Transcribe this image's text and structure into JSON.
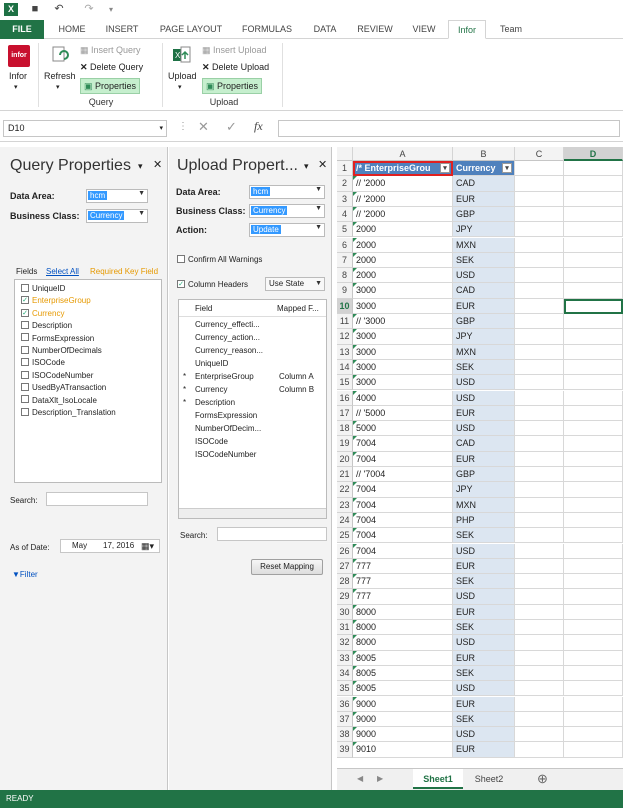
{
  "qat": {
    "logo": "X",
    "save_icon": "save-icon",
    "undo_icon": "undo-icon",
    "redo_icon": "redo-icon"
  },
  "tabs": [
    "FILE",
    "HOME",
    "INSERT",
    "PAGE LAYOUT",
    "FORMULAS",
    "DATA",
    "REVIEW",
    "VIEW",
    "Infor",
    "Team"
  ],
  "active_tab": "Infor",
  "ribbon": {
    "infor_label": "Infor",
    "infor_logo": "infor",
    "refresh_label": "Refresh",
    "insert_query": "Insert Query",
    "delete_query": "Delete Query",
    "query_properties": "Properties",
    "query_group": "Query",
    "upload_label": "Upload",
    "insert_upload": "Insert Upload",
    "delete_upload": "Delete Upload",
    "upload_properties": "Properties",
    "upload_group": "Upload"
  },
  "formula_bar": {
    "name_box": "D10",
    "cancel": "✕",
    "enter": "✓",
    "fx": "fx",
    "formula": ""
  },
  "query_panel": {
    "title": "Query Properties",
    "data_area_label": "Data Area:",
    "data_area_value": "hcm",
    "business_class_label": "Business Class:",
    "business_class_value": "Currency",
    "fields_label": "Fields",
    "select_all": "Select All",
    "required_key": "Required Key Field",
    "fields": [
      {
        "label": "UniqueID",
        "checked": false,
        "required": false
      },
      {
        "label": "EnterpriseGroup",
        "checked": true,
        "required": true
      },
      {
        "label": "Currency",
        "checked": true,
        "required": true
      },
      {
        "label": "Description",
        "checked": false,
        "required": false
      },
      {
        "label": "FormsExpression",
        "checked": false,
        "required": false
      },
      {
        "label": "NumberOfDecimals",
        "checked": false,
        "required": false
      },
      {
        "label": "ISOCode",
        "checked": false,
        "required": false
      },
      {
        "label": "ISOCodeNumber",
        "checked": false,
        "required": false
      },
      {
        "label": "UsedByATransaction",
        "checked": false,
        "required": false
      },
      {
        "label": "DataXlt_IsoLocale",
        "checked": false,
        "required": false
      },
      {
        "label": "Description_Translation",
        "checked": false,
        "required": false
      }
    ],
    "search_label": "Search:",
    "as_of_date_label": "As of Date:",
    "as_of_month": "May",
    "as_of_day": "17, 2016",
    "filter_label": "Filter"
  },
  "upload_panel": {
    "title": "Upload Propert...",
    "data_area_label": "Data Area:",
    "data_area_value": "hcm",
    "business_class_label": "Business Class:",
    "business_class_value": "Currency",
    "action_label": "Action:",
    "action_value": "Update",
    "confirm_warnings": "Confirm All Warnings",
    "column_headers": "Column Headers",
    "use_state": "Use State",
    "field_header": "Field",
    "mapped_header": "Mapped F...",
    "mappings": [
      {
        "star": "",
        "field": "Currency_effecti...",
        "mapped": ""
      },
      {
        "star": "",
        "field": "Currency_action...",
        "mapped": ""
      },
      {
        "star": "",
        "field": "Currency_reason...",
        "mapped": ""
      },
      {
        "star": "",
        "field": "UniqueID",
        "mapped": ""
      },
      {
        "star": "*",
        "field": "EnterpriseGroup",
        "mapped": "Column A"
      },
      {
        "star": "*",
        "field": "Currency",
        "mapped": "Column B"
      },
      {
        "star": "*",
        "field": "Description",
        "mapped": ""
      },
      {
        "star": "",
        "field": "FormsExpression",
        "mapped": ""
      },
      {
        "star": "",
        "field": "NumberOfDecim...",
        "mapped": ""
      },
      {
        "star": "",
        "field": "ISOCode",
        "mapped": ""
      },
      {
        "star": "",
        "field": "ISOCodeNumber",
        "mapped": ""
      }
    ],
    "search_label": "Search:",
    "reset_mapping": "Reset Mapping"
  },
  "grid": {
    "columns": [
      "A",
      "B",
      "C",
      "D"
    ],
    "selected_col": "D",
    "selected_row": 10,
    "header_a": "/* EnterpriseGrou",
    "header_b": "Currency",
    "rows": [
      [
        "// '2000",
        "CAD"
      ],
      [
        "// '2000",
        "EUR"
      ],
      [
        "// '2000",
        "GBP"
      ],
      [
        "2000",
        "JPY"
      ],
      [
        "2000",
        "MXN"
      ],
      [
        "2000",
        "SEK"
      ],
      [
        "2000",
        "USD"
      ],
      [
        "3000",
        "CAD"
      ],
      [
        "3000",
        "EUR"
      ],
      [
        "// '3000",
        "GBP"
      ],
      [
        "3000",
        "JPY"
      ],
      [
        "3000",
        "MXN"
      ],
      [
        "3000",
        "SEK"
      ],
      [
        "3000",
        "USD"
      ],
      [
        "4000",
        "USD"
      ],
      [
        "// '5000",
        "EUR"
      ],
      [
        "5000",
        "USD"
      ],
      [
        "7004",
        "CAD"
      ],
      [
        "7004",
        "EUR"
      ],
      [
        "// '7004",
        "GBP"
      ],
      [
        "7004",
        "JPY"
      ],
      [
        "7004",
        "MXN"
      ],
      [
        "7004",
        "PHP"
      ],
      [
        "7004",
        "SEK"
      ],
      [
        "7004",
        "USD"
      ],
      [
        "777",
        "EUR"
      ],
      [
        "777",
        "SEK"
      ],
      [
        "777",
        "USD"
      ],
      [
        "8000",
        "EUR"
      ],
      [
        "8000",
        "SEK"
      ],
      [
        "8000",
        "USD"
      ],
      [
        "8005",
        "EUR"
      ],
      [
        "8005",
        "SEK"
      ],
      [
        "8005",
        "USD"
      ],
      [
        "9000",
        "EUR"
      ],
      [
        "9000",
        "SEK"
      ],
      [
        "9000",
        "USD"
      ],
      [
        "9010",
        "EUR"
      ]
    ],
    "green_rows": [
      2,
      3,
      4,
      5,
      6,
      7,
      8,
      9,
      11,
      12,
      13,
      14,
      15,
      16,
      18,
      19,
      20,
      22,
      23,
      24,
      25,
      26,
      27,
      28,
      29,
      30,
      31,
      32,
      33,
      34,
      35,
      36,
      37,
      38,
      39
    ]
  },
  "sheets": [
    "Sheet1",
    "Sheet2"
  ],
  "active_sheet": "Sheet1",
  "add_sheet": "⊕",
  "status": "READY"
}
